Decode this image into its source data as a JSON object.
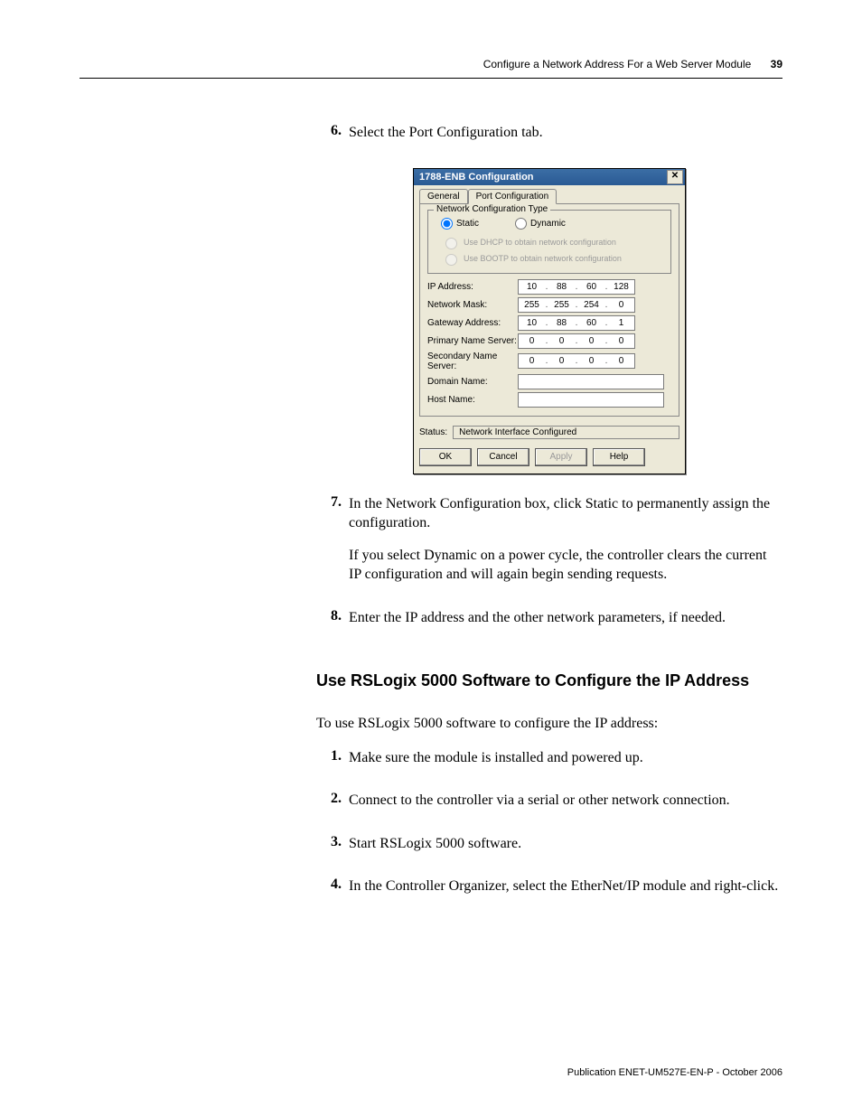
{
  "header": {
    "title": "Configure a Network Address For a Web Server Module",
    "page_number": "39"
  },
  "steps_a": [
    {
      "n": "6.",
      "text": "Select the Port Configuration tab."
    }
  ],
  "dialog": {
    "title": "1788-ENB Configuration",
    "close_glyph": "✕",
    "tabs": {
      "general": "General",
      "port": "Port Configuration"
    },
    "group_title": "Network Configuration Type",
    "radio_static": "Static",
    "radio_dynamic": "Dynamic",
    "dhcp_label": "Use DHCP to obtain network configuration",
    "bootp_label": "Use BOOTP to obtain network configuration",
    "fields": {
      "ip_label": "IP Address:",
      "ip": [
        "10",
        "88",
        "60",
        "128"
      ],
      "mask_label": "Network Mask:",
      "mask": [
        "255",
        "255",
        "254",
        "0"
      ],
      "gw_label": "Gateway Address:",
      "gw": [
        "10",
        "88",
        "60",
        "1"
      ],
      "pns_label": "Primary Name Server:",
      "pns": [
        "0",
        "0",
        "0",
        "0"
      ],
      "sns_label": "Secondary Name Server:",
      "sns": [
        "0",
        "0",
        "0",
        "0"
      ],
      "domain_label": "Domain Name:",
      "host_label": "Host Name:"
    },
    "status_label": "Status:",
    "status_value": "Network Interface Configured",
    "buttons": {
      "ok": "OK",
      "cancel": "Cancel",
      "apply": "Apply",
      "help": "Help"
    }
  },
  "steps_b": [
    {
      "n": "7.",
      "text": "In the Network Configuration box, click Static to permanently assign the configuration.",
      "extra": "If you select Dynamic on a power cycle, the controller clears the current IP configuration and will again begin sending requests."
    },
    {
      "n": "8.",
      "text": "Enter the IP address and the other network parameters, if needed."
    }
  ],
  "section_heading": "Use RSLogix 5000 Software to Configure the IP Address",
  "section_intro": "To use RSLogix 5000 software to configure the IP address:",
  "steps_c": [
    {
      "n": "1.",
      "text": "Make sure the module is installed and powered up."
    },
    {
      "n": "2.",
      "text": "Connect to the controller via a serial or other network connection."
    },
    {
      "n": "3.",
      "text": "Start RSLogix 5000 software."
    },
    {
      "n": "4.",
      "text": "In the Controller Organizer, select the EtherNet/IP module and right-click."
    }
  ],
  "footer": "Publication ENET-UM527E-EN-P - October 2006"
}
